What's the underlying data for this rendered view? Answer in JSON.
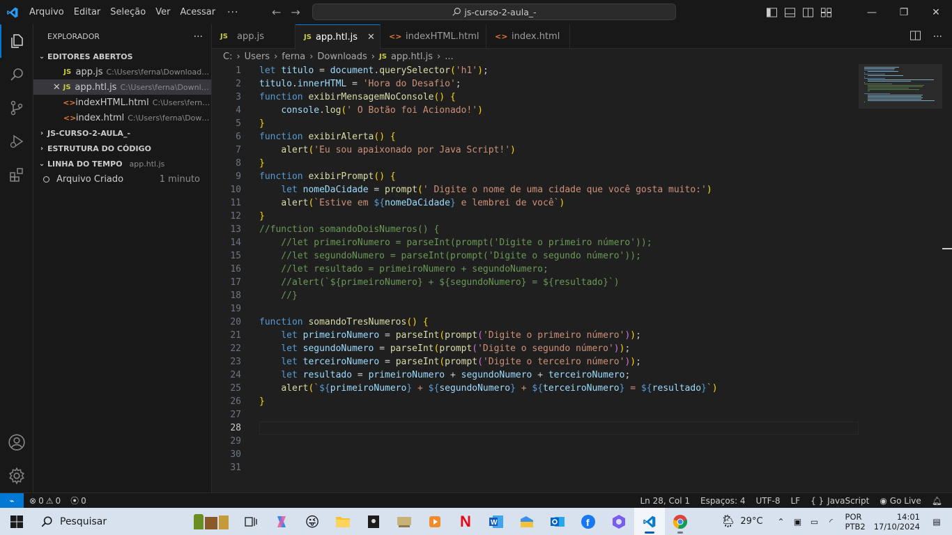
{
  "titlebar": {
    "menus": [
      "Arquivo",
      "Editar",
      "Seleção",
      "Ver",
      "Acessar"
    ],
    "more": "···",
    "back_arrow": "←",
    "forward_arrow": "→",
    "command_center": "js-curso-2-aula_-",
    "window_controls": {
      "minimize": "—",
      "restore": "❐",
      "close": "✕"
    }
  },
  "sidebar": {
    "header": "EXPLORADOR",
    "header_more": "···",
    "open_editors": {
      "title": "EDITORES ABERTOS",
      "items": [
        {
          "icon": "JS",
          "name": "app.js",
          "path": "C:\\Users\\ferna\\Downloads\\...",
          "selected": false
        },
        {
          "icon": "JS",
          "name": "app.htl.js",
          "path": "C:\\Users\\ferna\\Downloa...",
          "selected": true
        },
        {
          "icon": "<>",
          "name": "indexHTML.html",
          "path": "C:\\Users\\ferna\\...",
          "selected": false
        },
        {
          "icon": "<>",
          "name": "index.html",
          "path": "C:\\Users\\ferna\\Downl...",
          "selected": false
        }
      ]
    },
    "folder": "JS-CURSO-2-AULA_-",
    "outline": "ESTRUTURA DO CÓDIGO",
    "timeline": {
      "title": "LINHA DO TEMPO",
      "file": "app.htl.js",
      "entries": [
        {
          "label": "Arquivo Criado",
          "time": "1 minuto"
        }
      ]
    }
  },
  "tabs": [
    {
      "icon": "JS",
      "label": "app.js",
      "active": false
    },
    {
      "icon": "JS",
      "label": "app.htl.js",
      "active": true,
      "close": "✕"
    },
    {
      "icon": "<>",
      "label": "indexHTML.html",
      "active": false
    },
    {
      "icon": "<>",
      "label": "index.html",
      "active": false
    }
  ],
  "breadcrumb": {
    "parts": [
      "C:",
      "Users",
      "ferna",
      "Downloads"
    ],
    "sep": "›",
    "file_icon": "JS",
    "file": "app.htl.js",
    "tail": "..."
  },
  "editor": {
    "current_line": 28,
    "line_numbers": [
      "1",
      "2",
      "3",
      "4",
      "5",
      "6",
      "7",
      "8",
      "9",
      "10",
      "11",
      "12",
      "13",
      "14",
      "15",
      "16",
      "17",
      "18",
      "19",
      "20",
      "21",
      "22",
      "23",
      "24",
      "25",
      "26",
      "27",
      "28",
      "29",
      "30",
      "31"
    ],
    "code_lines": [
      "let titulo = document.querySelector('h1');",
      "titulo.innerHTML = 'Hora do Desafio';",
      "function exibirMensagemNoConsole() {",
      "    console.log(' O Botão foi Acionado!')",
      "}",
      "function exibirAlerta() {",
      "    alert('Eu sou apaixonado por Java Script!')",
      "}",
      "function exibirPrompt() {",
      "    let nomeDaCidade = prompt(' Digite o nome de uma cidade que você gosta muito:')",
      "    alert(`Estive em ${nomeDaCidade} e lembrei de você`)",
      "}",
      "//function somandoDoisNumeros() {",
      "    //let primeiroNumero = parseInt(prompt('Digite o primeiro número'));",
      "    //let segundoNumero = parseInt(prompt('Digite o segundo número'));",
      "    //let resultado = primeiroNumero + segundoNumero;",
      "    //alert(`${primeiroNumero} + ${segundoNumero} = ${resultado}`)",
      "    //}",
      "",
      "function somandoTresNumeros() {",
      "    let primeiroNumero = parseInt(prompt('Digite o primeiro número'));",
      "    let segundoNumero = parseInt(prompt('Digite o segundo número'));",
      "    let terceiroNumero = parseInt(prompt('Digite o terceiro número'));",
      "    let resultado = primeiroNumero + segundoNumero + terceiroNumero;",
      "    alert(`${primeiroNumero} + ${segundoNumero} + ${terceiroNumero} = ${resultado}`)",
      "}",
      "",
      "",
      "",
      "",
      ""
    ]
  },
  "statusbar": {
    "remote": "⌁",
    "errors": "0",
    "warnings": "0",
    "ports": "0",
    "position": "Ln 28, Col 1",
    "spaces": "Espaços: 4",
    "encoding": "UTF-8",
    "eol": "LF",
    "language_prefix": "{ }",
    "language": "JavaScript",
    "golive": "Go Live"
  },
  "taskbar": {
    "search_placeholder": "Pesquisar",
    "weather": "29°C",
    "lang_line1": "POR",
    "lang_line2": "PTB2",
    "time": "14:01",
    "date": "17/10/2024"
  },
  "colors": {
    "accent": "#0078d4",
    "keyword": "#569cd6",
    "function": "#dcdcaa",
    "variable": "#9cdcfe",
    "string": "#ce9178",
    "comment": "#6a9955"
  }
}
